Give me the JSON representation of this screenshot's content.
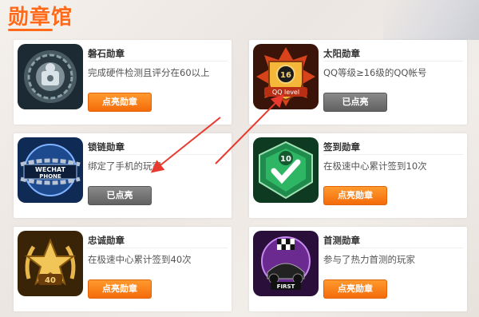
{
  "page": {
    "title": "勋章馆"
  },
  "cards": [
    {
      "name": "磐石勋章",
      "desc": "完成硬件检测且评分在60以上",
      "button": "点亮勋章",
      "state": "orange",
      "icon": "rock-medal-icon"
    },
    {
      "name": "太阳勋章",
      "desc": "QQ等级≥16级的QQ帐号",
      "button": "已点亮",
      "state": "gray",
      "icon": "sun-medal-icon",
      "badge_text": "16",
      "badge_sub": "QQ level"
    },
    {
      "name": "锁链勋章",
      "desc": "绑定了手机的玩家",
      "button": "已点亮",
      "state": "gray",
      "icon": "chain-medal-icon",
      "badge_text": "WECHAT",
      "badge_sub": "PHONE"
    },
    {
      "name": "签到勋章",
      "desc": "在极速中心累计签到10次",
      "button": "点亮勋章",
      "state": "orange",
      "icon": "checkin-medal-icon",
      "badge_text": "10"
    },
    {
      "name": "忠诚勋章",
      "desc": "在极速中心累计签到40次",
      "button": "点亮勋章",
      "state": "orange",
      "icon": "loyalty-medal-icon",
      "badge_text": "40"
    },
    {
      "name": "首测勋章",
      "desc": "参与了热力首测的玩家",
      "button": "点亮勋章",
      "state": "orange",
      "icon": "first-test-medal-icon",
      "badge_text": "FIRST"
    }
  ],
  "colors": {
    "accent": "#ff6a1a",
    "button_orange": "#f46b0a",
    "button_gray": "#616161",
    "arrow": "#e83a2e"
  }
}
